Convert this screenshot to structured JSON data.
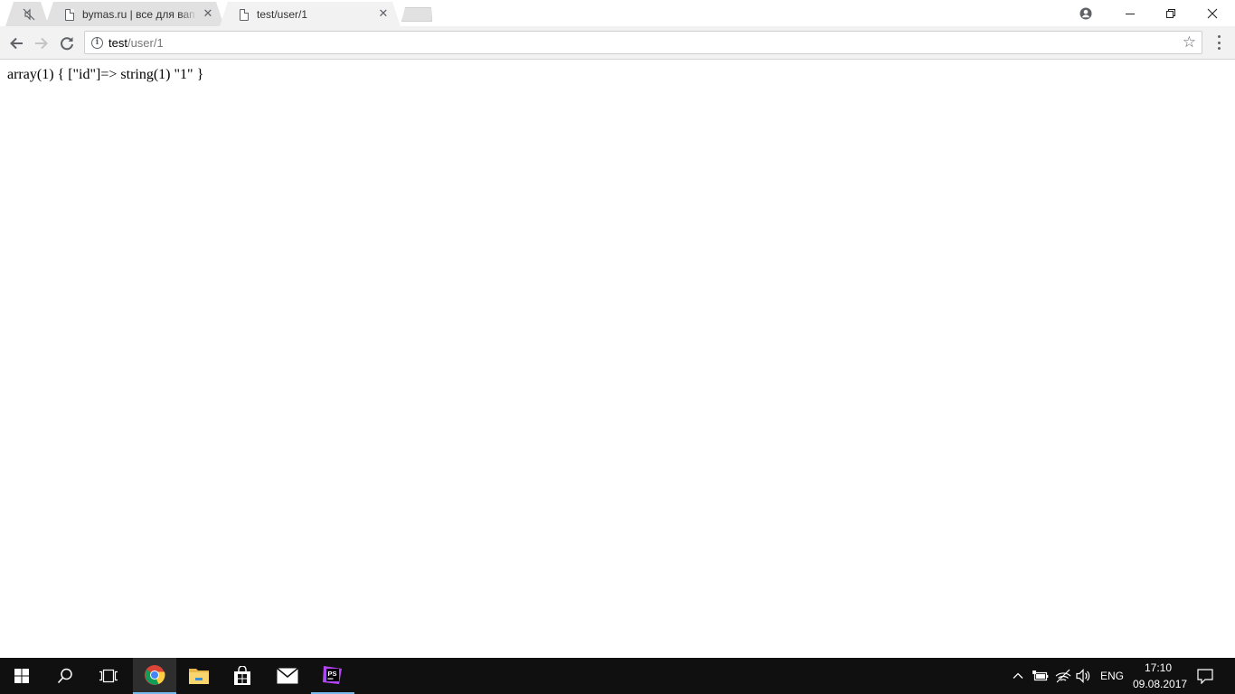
{
  "browser": {
    "tabs": [
      {
        "title": "",
        "muted": true
      },
      {
        "title": "bymas.ru | все для вап м",
        "muted": false
      },
      {
        "title": "test/user/1",
        "muted": false,
        "active": true
      }
    ],
    "address": {
      "host": "test",
      "path": "/user/1"
    }
  },
  "page": {
    "text": "array(1) { [\"id\"]=> string(1) \"1\" }"
  },
  "taskbar": {
    "language": "ENG",
    "time": "17:10",
    "date": "09.08.2017",
    "apps": [
      "start",
      "search",
      "task-view",
      "chrome",
      "file-explorer",
      "store",
      "mail",
      "phpstorm"
    ]
  },
  "colors": {
    "taskbar_bg": "#101010",
    "accent": "#76b9ed",
    "tab_active": "#f2f2f2",
    "tab_inactive": "#e1e1e1"
  }
}
